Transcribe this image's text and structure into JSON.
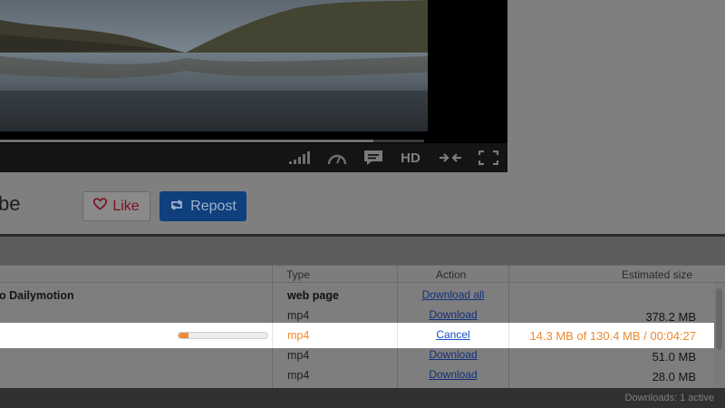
{
  "video": {
    "player_controls": [
      {
        "icon": "signal-bars-icon"
      },
      {
        "icon": "speedometer-icon"
      },
      {
        "icon": "subtitles-icon"
      },
      {
        "icon": "hd-icon",
        "text": "HD"
      },
      {
        "icon": "collapse-arrows-icon"
      },
      {
        "icon": "fullscreen-icon"
      }
    ],
    "progress": 0.88
  },
  "page": {
    "title_fragment": "be",
    "like_label": "Like",
    "repost_label": "Repost"
  },
  "downloads": {
    "columns": {
      "type": "Type",
      "action": "Action",
      "size": "Estimated size"
    },
    "rows": [
      {
        "name": "o Dailymotion",
        "type": "web page",
        "action": "Download all",
        "size": "",
        "state": "group"
      },
      {
        "name": "",
        "type": "mp4",
        "action": "Download",
        "size": "378.2 MB",
        "state": "idle"
      },
      {
        "name": "",
        "type": "mp4",
        "action": "Cancel",
        "size": "14.3 MB of 130.4 MB / 00:04:27",
        "state": "active",
        "progress": 0.11
      },
      {
        "name": "",
        "type": "mp4",
        "action": "Download",
        "size": "51.0 MB",
        "state": "idle"
      },
      {
        "name": "",
        "type": "mp4",
        "action": "Download",
        "size": "28.0 MB",
        "state": "idle"
      }
    ],
    "status": "Downloads: 1 active"
  },
  "colors": {
    "accent_orange": "#ee8a2c",
    "repost_blue": "#0f3f7c",
    "like_red": "#c0152d",
    "link_blue": "#1a4ec9"
  }
}
